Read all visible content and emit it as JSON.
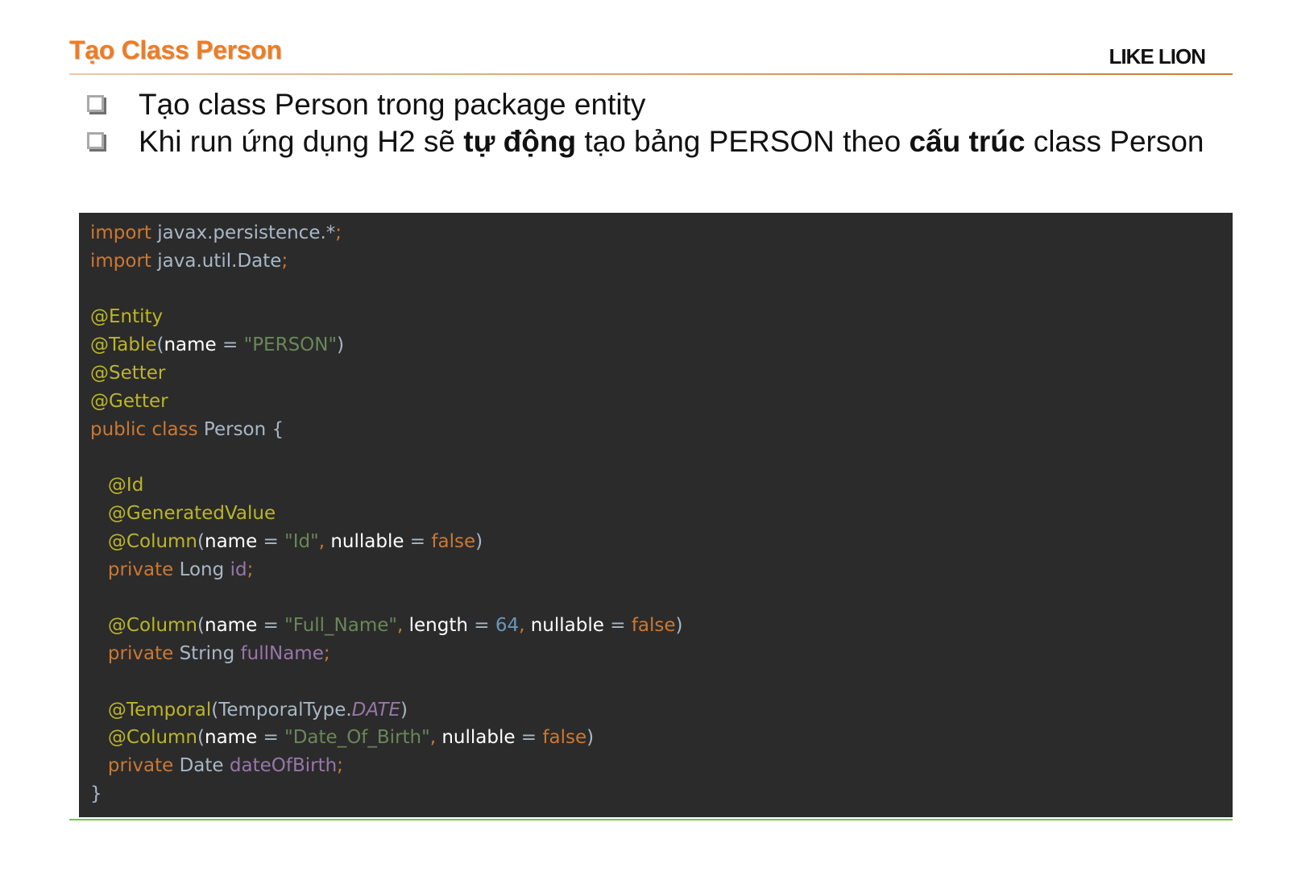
{
  "header": {
    "title": "Tạo Class Person",
    "logo": "LIKE LION"
  },
  "bullets": [
    {
      "segments": [
        {
          "text": "Tạo class Person trong package entity",
          "bold": false
        }
      ]
    },
    {
      "segments": [
        {
          "text": "Khi run ứng dụng H2 sẽ ",
          "bold": false
        },
        {
          "text": "tự động",
          "bold": true
        },
        {
          "text": " tạo bảng PERSON theo ",
          "bold": false
        },
        {
          "text": "cấu trúc",
          "bold": true
        },
        {
          "text": " class Person",
          "bold": false
        }
      ]
    }
  ],
  "code": {
    "lines": [
      [
        {
          "t": "import ",
          "c": "kw"
        },
        {
          "t": "javax.persistence.*",
          "c": "plain"
        },
        {
          "t": ";",
          "c": "kw"
        }
      ],
      [
        {
          "t": "import ",
          "c": "kw"
        },
        {
          "t": "java.util.Date",
          "c": "plain"
        },
        {
          "t": ";",
          "c": "kw"
        }
      ],
      [],
      [
        {
          "t": "@Entity",
          "c": "ann"
        }
      ],
      [
        {
          "t": "@Table",
          "c": "ann"
        },
        {
          "t": "(",
          "c": "plain"
        },
        {
          "t": "name",
          "c": "param"
        },
        {
          "t": " = ",
          "c": "plain"
        },
        {
          "t": "\"PERSON\"",
          "c": "str"
        },
        {
          "t": ")",
          "c": "plain"
        }
      ],
      [
        {
          "t": "@Setter",
          "c": "ann"
        }
      ],
      [
        {
          "t": "@Getter",
          "c": "ann"
        }
      ],
      [
        {
          "t": "public class ",
          "c": "kw"
        },
        {
          "t": "Person {",
          "c": "plain"
        }
      ],
      [],
      [
        {
          "t": "   @Id",
          "c": "ann"
        }
      ],
      [
        {
          "t": "   @GeneratedValue",
          "c": "ann"
        }
      ],
      [
        {
          "t": "   @Column",
          "c": "ann"
        },
        {
          "t": "(",
          "c": "plain"
        },
        {
          "t": "name",
          "c": "param"
        },
        {
          "t": " = ",
          "c": "plain"
        },
        {
          "t": "\"Id\"",
          "c": "str"
        },
        {
          "t": ", ",
          "c": "kw"
        },
        {
          "t": "nullable",
          "c": "param"
        },
        {
          "t": " = ",
          "c": "plain"
        },
        {
          "t": "false",
          "c": "kw"
        },
        {
          "t": ")",
          "c": "plain"
        }
      ],
      [
        {
          "t": "   private ",
          "c": "kw"
        },
        {
          "t": "Long ",
          "c": "plain"
        },
        {
          "t": "id",
          "c": "fld"
        },
        {
          "t": ";",
          "c": "kw"
        }
      ],
      [],
      [
        {
          "t": "   @Column",
          "c": "ann"
        },
        {
          "t": "(",
          "c": "plain"
        },
        {
          "t": "name",
          "c": "param"
        },
        {
          "t": " = ",
          "c": "plain"
        },
        {
          "t": "\"Full_Name\"",
          "c": "str"
        },
        {
          "t": ", ",
          "c": "kw"
        },
        {
          "t": "length",
          "c": "param"
        },
        {
          "t": " = ",
          "c": "plain"
        },
        {
          "t": "64",
          "c": "num"
        },
        {
          "t": ", ",
          "c": "kw"
        },
        {
          "t": "nullable",
          "c": "param"
        },
        {
          "t": " = ",
          "c": "plain"
        },
        {
          "t": "false",
          "c": "kw"
        },
        {
          "t": ")",
          "c": "plain"
        }
      ],
      [
        {
          "t": "   private ",
          "c": "kw"
        },
        {
          "t": "String ",
          "c": "plain"
        },
        {
          "t": "fullName",
          "c": "fld"
        },
        {
          "t": ";",
          "c": "kw"
        }
      ],
      [],
      [
        {
          "t": "   @Temporal",
          "c": "ann"
        },
        {
          "t": "(TemporalType.",
          "c": "plain"
        },
        {
          "t": "DATE",
          "c": "fld-ital"
        },
        {
          "t": ")",
          "c": "plain"
        }
      ],
      [
        {
          "t": "   @Column",
          "c": "ann"
        },
        {
          "t": "(",
          "c": "plain"
        },
        {
          "t": "name",
          "c": "param"
        },
        {
          "t": " = ",
          "c": "plain"
        },
        {
          "t": "\"Date_Of_Birth\"",
          "c": "str"
        },
        {
          "t": ", ",
          "c": "kw"
        },
        {
          "t": "nullable",
          "c": "param"
        },
        {
          "t": " = ",
          "c": "plain"
        },
        {
          "t": "false",
          "c": "kw"
        },
        {
          "t": ")",
          "c": "plain"
        }
      ],
      [
        {
          "t": "   private ",
          "c": "kw"
        },
        {
          "t": "Date ",
          "c": "plain"
        },
        {
          "t": "dateOfBirth",
          "c": "fld"
        },
        {
          "t": ";",
          "c": "kw"
        }
      ],
      [
        {
          "t": "}",
          "c": "plain"
        }
      ]
    ]
  },
  "colors": {
    "title": "#ee7d22",
    "code_background": "#2b2b2b",
    "bottom_rule": "#7ac143"
  }
}
